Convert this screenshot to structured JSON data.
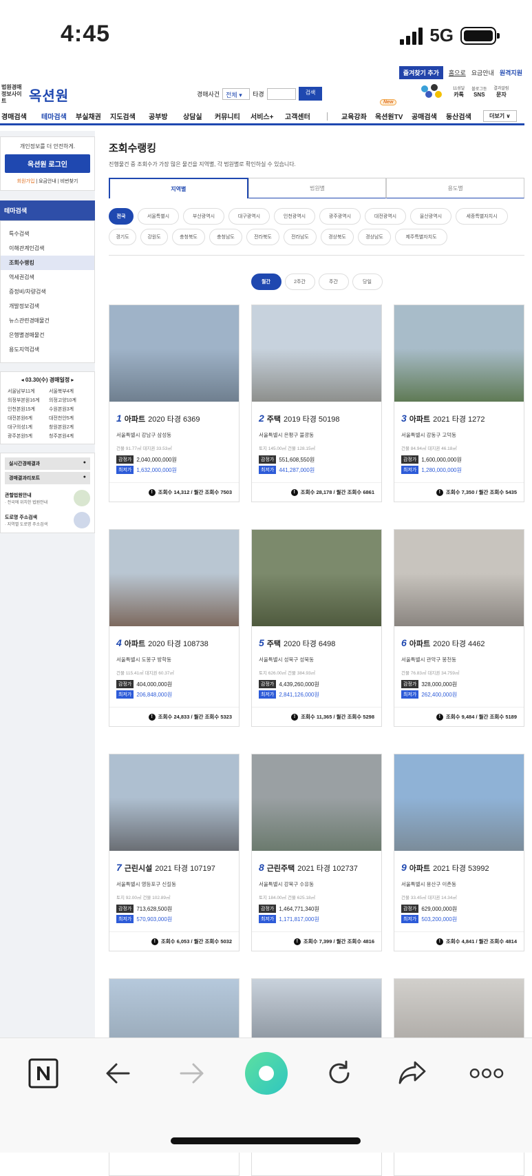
{
  "status": {
    "time": "4:45",
    "network": "5G"
  },
  "topbar": {
    "fav": "즐겨찾기 추가",
    "home": "홈으로",
    "pricing": "요금안내",
    "remote": "원격지원"
  },
  "logo": {
    "sub": "법원경매 정보사이트",
    "main": "옥션원"
  },
  "search": {
    "label": "경매사건",
    "select_value": "전체",
    "year_label": "타경",
    "button": "검색"
  },
  "sns": {
    "kakao_top": "11성달",
    "kakao": "카톡",
    "sns_top": "블로그등",
    "sns": "SNS",
    "sms_top": "결과알림",
    "sms": "문자"
  },
  "nav": {
    "items": [
      "경매검색",
      "테마검색",
      "부실채권",
      "지도검색",
      "공부방",
      "상담실",
      "커뮤니티",
      "서비스+",
      "고객센터",
      "교육강좌",
      "옥션원TV",
      "공매검색",
      "동산검색"
    ],
    "new_badge": "New",
    "more": "더보기 ∨"
  },
  "sidebar": {
    "login_note": "개인정보를 더 안전하게.",
    "login_button": "옥션원 로그인",
    "signup": "회원가입",
    "pricing": "요금안내",
    "find_pw": "비번찾기",
    "section": "테마검색",
    "menu": [
      "특수검색",
      "이해관계인검색",
      "조회수랭킹",
      "역세권검색",
      "증정비/차량검색",
      "개발정보검색",
      "뉴스관련경매물건",
      "은행별경매물건",
      "용도지역검색"
    ],
    "schedule_title": "03.30(수) 경매일정",
    "schedule": [
      "서울남부11계",
      "서울북부4계",
      "의정부본원16계",
      "의정고양10계",
      "인천본원15계",
      "수원본원3계",
      "대전본원6계",
      "대전천안5계",
      "대구의성1계",
      "창원본원2계",
      "광주본원5계",
      "청주본원4계"
    ],
    "quick1": "실시간경매결과",
    "quick2": "경매결과리포트",
    "court_title": "관할법원안내",
    "court_sub": "· 전국에 위치한 법원안내",
    "road_title": "도로명 주소검색",
    "road_sub": "· 지역별 도로명 주소검색"
  },
  "main": {
    "title": "조회수랭킹",
    "desc": "진행물건 중 조회수가 가장 많은 물건을 지역별, 각 법원별로 확인하실 수 있습니다.",
    "tabs": [
      "지역별",
      "법원별",
      "용도별"
    ],
    "regions": [
      "전국",
      "서울특별시",
      "부산광역시",
      "대구광역시",
      "인천광역시",
      "광주광역시",
      "대전광역시",
      "울산광역시",
      "세종특별자치시",
      "경기도",
      "강원도",
      "충청북도",
      "충청남도",
      "전라북도",
      "전라남도",
      "경상북도",
      "경상남도",
      "제주특별자치도"
    ],
    "periods": [
      "월간",
      "2주간",
      "주간",
      "당일"
    ]
  },
  "labels": {
    "appraisal": "감정가",
    "minimum": "최저가"
  },
  "cards": [
    {
      "rank": "1",
      "kind": "아파트",
      "case": "2020 타경 6369",
      "addr": "서울특별시 강남구 삼성동",
      "area": "건물 91.77㎡    대지권 33.53㎡",
      "appraisal": "2,040,000,000원",
      "minimum": "1,632,000,000원",
      "views": "조회수 14,312 / 월간 조회수 7503"
    },
    {
      "rank": "2",
      "kind": "주택",
      "case": "2019 타경 50198",
      "addr": "서울특별시 은평구 불광동",
      "area": "토지 145.00㎡    건물 128.15㎡",
      "appraisal": "551,608,550원",
      "minimum": "441,287,000원",
      "views": "조회수 28,178 / 월간 조회수 6861"
    },
    {
      "rank": "3",
      "kind": "아파트",
      "case": "2021 타경 1272",
      "addr": "서울특별시 강동구 고덕동",
      "area": "건물 84.94㎡    대지권 46.18㎡",
      "appraisal": "1,600,000,000원",
      "minimum": "1,280,000,000원",
      "views": "조회수 7,350 / 월간 조회수 5435"
    },
    {
      "rank": "4",
      "kind": "아파트",
      "case": "2020 타경 108738",
      "addr": "서울특별시 도봉구 방학동",
      "area": "건물 115.41㎡    대지권 60.37㎡",
      "appraisal": "404,000,000원",
      "minimum": "206,848,000원",
      "views": "조회수 24,833 / 월간 조회수 5323"
    },
    {
      "rank": "5",
      "kind": "주택",
      "case": "2020 타경 6498",
      "addr": "서울특별시 성북구 성북동",
      "area": "토지 626.00㎡    건물 384.93㎡",
      "appraisal": "4,439,260,000원",
      "minimum": "2,841,126,000원",
      "views": "조회수 11,365 / 월간 조회수 5298"
    },
    {
      "rank": "6",
      "kind": "아파트",
      "case": "2020 타경 4462",
      "addr": "서울특별시 관악구 봉천동",
      "area": "건물 76.83㎡    대지권 34.759㎡",
      "appraisal": "328,000,000원",
      "minimum": "262,400,000원",
      "views": "조회수 9,484 / 월간 조회수 5189"
    },
    {
      "rank": "7",
      "kind": "근린시설",
      "case": "2021 타경 107197",
      "addr": "서울특별시 영등포구 신길동",
      "area": "토지 92.00㎡    건물 102.89㎡",
      "appraisal": "713,628,500원",
      "minimum": "570,903,000원",
      "views": "조회수 6,053 / 월간 조회수 5032"
    },
    {
      "rank": "8",
      "kind": "근린주택",
      "case": "2021 타경 102737",
      "addr": "서울특별시 강북구 수유동",
      "area": "토지 184.00㎡    건물 625.18㎡",
      "appraisal": "1,464,771,340원",
      "minimum": "1,171,817,000원",
      "views": "조회수 7,399 / 월간 조회수 4816"
    },
    {
      "rank": "9",
      "kind": "아파트",
      "case": "2021 타경 53992",
      "addr": "서울특별시 용산구 이촌동",
      "area": "건물 33.45㎡    대지권 14.34㎡",
      "appraisal": "629,000,000원",
      "minimum": "503,200,000원",
      "views": "조회수 4,841 / 월간 조회수 4814"
    }
  ],
  "photo_note": "本件",
  "colors": {
    "brand": "#1f48b0",
    "minimum": "#2d5bd8"
  }
}
